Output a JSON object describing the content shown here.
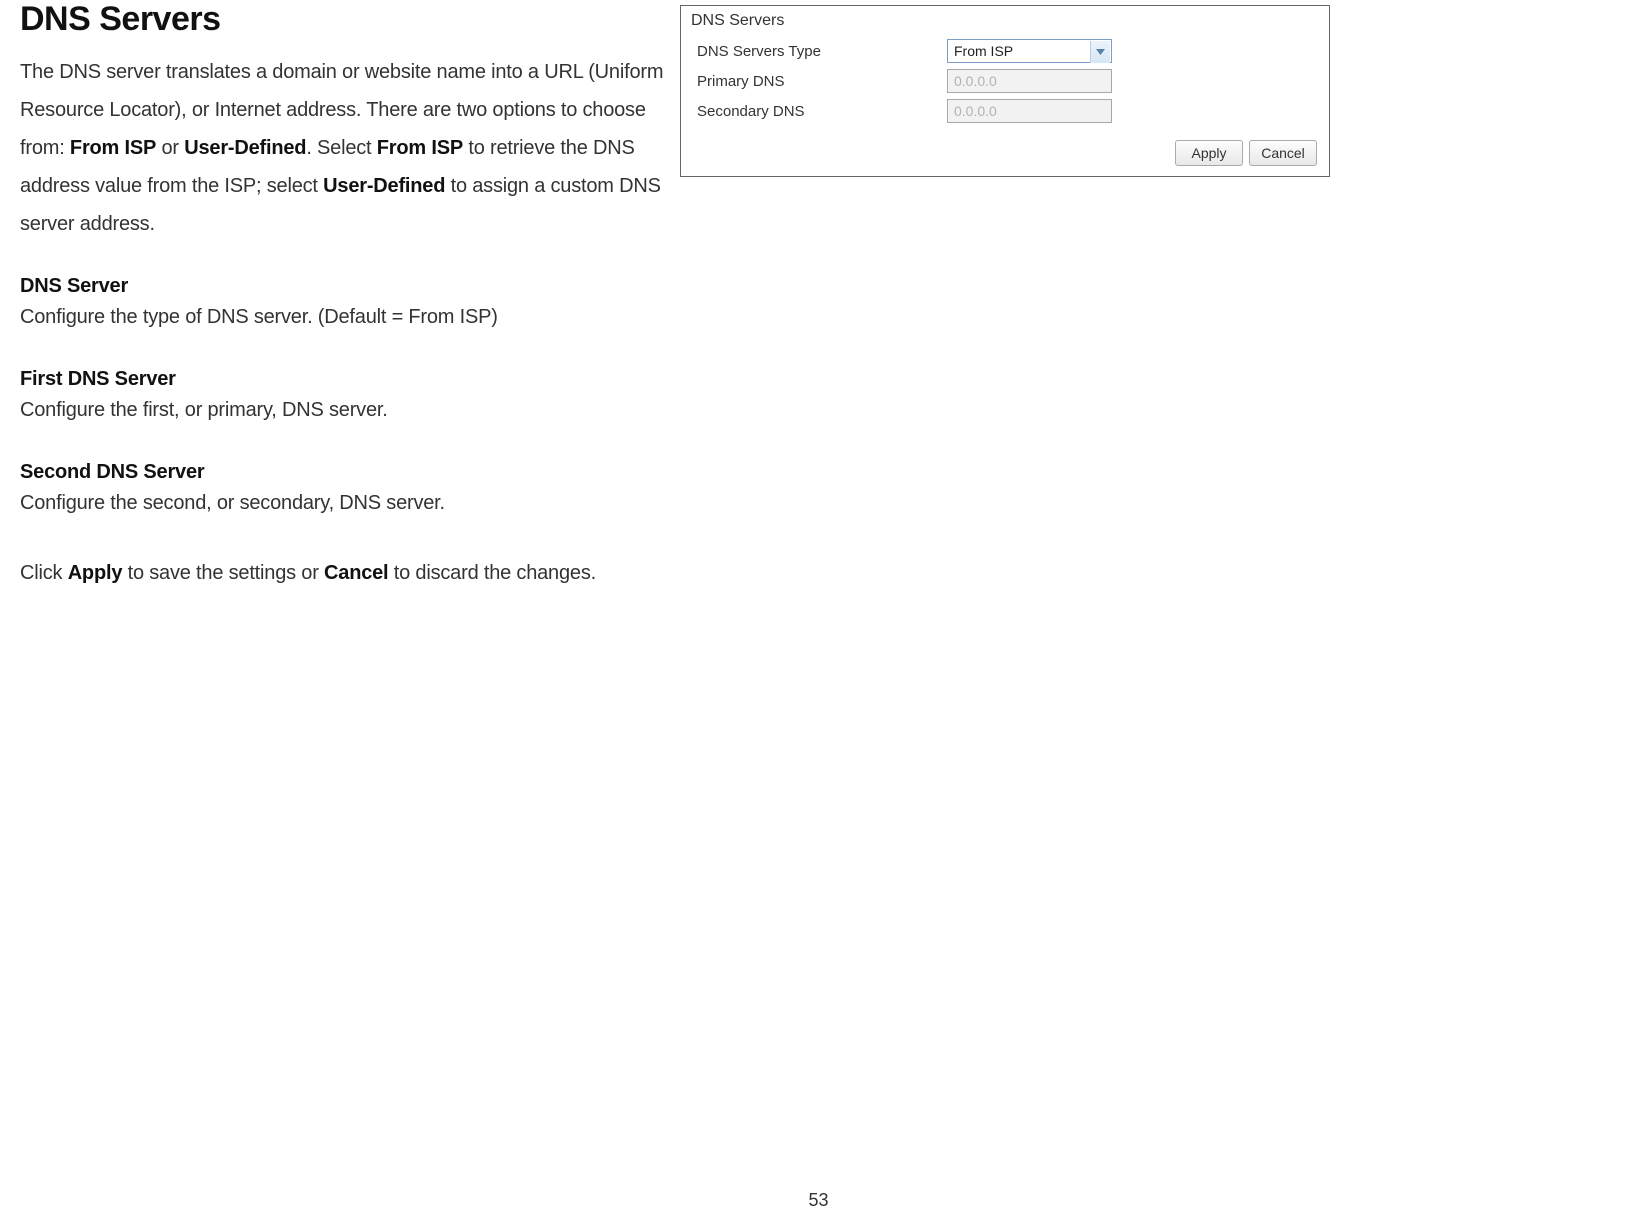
{
  "heading": "DNS Servers",
  "intro": {
    "t1": "The DNS server translates a domain or website name into a URL (Uniform Resource Locator), or Internet address. There are two options to choose from: ",
    "b1": "From ISP",
    "t2": " or ",
    "b2": "User-Defined",
    "t3": ". Select ",
    "b3": "From ISP",
    "t4": " to retrieve the DNS address value from the ISP; select ",
    "b4": "User-Defined",
    "t5": " to assign a custom DNS server address."
  },
  "sections": {
    "dns_server": {
      "title": "DNS Server",
      "desc": "Configure the type of DNS server. (Default = From ISP)"
    },
    "first": {
      "title": "First DNS Server",
      "desc": "Configure the first, or primary, DNS server."
    },
    "second": {
      "title": "Second DNS Server",
      "desc": "Configure the second, or secondary, DNS server."
    }
  },
  "apply_line": {
    "t1": "Click ",
    "b1": "Apply",
    "t2": " to save the settings or ",
    "b2": "Cancel",
    "t3": " to discard the changes."
  },
  "panel": {
    "title": "DNS Servers",
    "rows": {
      "type": {
        "label": "DNS Servers Type",
        "value": "From ISP"
      },
      "primary": {
        "label": "Primary DNS",
        "value": "0.0.0.0"
      },
      "secondary": {
        "label": "Secondary DNS",
        "value": "0.0.0.0"
      }
    },
    "buttons": {
      "apply": "Apply",
      "cancel": "Cancel"
    }
  },
  "page_number": "53"
}
